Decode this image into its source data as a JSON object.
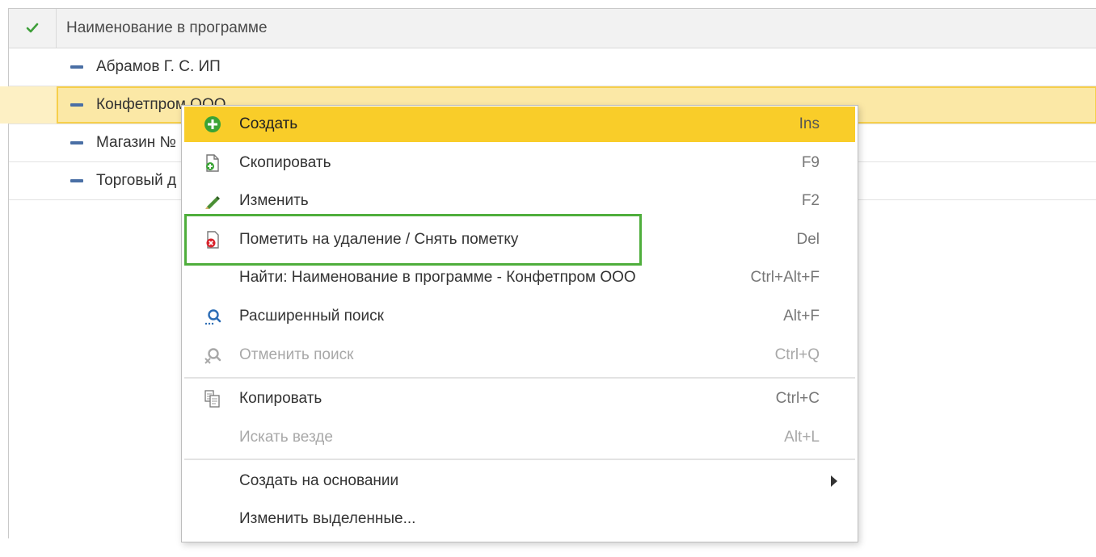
{
  "table": {
    "header_title": "Наименование в программе",
    "rows": [
      {
        "name": "Абрамов Г. С. ИП"
      },
      {
        "name": "Конфетпром ООО"
      },
      {
        "name": "Магазин №"
      },
      {
        "name": "Торговый д"
      }
    ]
  },
  "menu": {
    "items": [
      {
        "label": "Создать",
        "shortcut": "Ins",
        "icon": "plus-circle-icon",
        "state": "active"
      },
      {
        "label": "Скопировать",
        "shortcut": "F9",
        "icon": "copy-document-icon"
      },
      {
        "label": "Изменить",
        "shortcut": "F2",
        "icon": "pencil-icon"
      },
      {
        "label": "Пометить на удаление / Снять пометку",
        "shortcut": "Del",
        "icon": "delete-mark-icon"
      },
      {
        "label": "Найти: Наименование в программе - Конфетпром ООО",
        "shortcut": "Ctrl+Alt+F"
      },
      {
        "label": "Расширенный поиск",
        "shortcut": "Alt+F",
        "icon": "search-icon"
      },
      {
        "label": "Отменить поиск",
        "shortcut": "Ctrl+Q",
        "icon": "cancel-search-icon",
        "state": "disabled"
      },
      {
        "label": "Копировать",
        "shortcut": "Ctrl+C",
        "icon": "clipboard-copy-icon"
      },
      {
        "label": "Искать везде",
        "shortcut": "Alt+L",
        "state": "disabled"
      },
      {
        "label": "Создать на основании",
        "icon": "submenu-arrow-icon"
      },
      {
        "label": "Изменить выделенные..."
      }
    ]
  },
  "colors": {
    "selection": "#f9cd29",
    "highlight_box": "#4fae3c",
    "row_dash": "#4a6fa5"
  }
}
